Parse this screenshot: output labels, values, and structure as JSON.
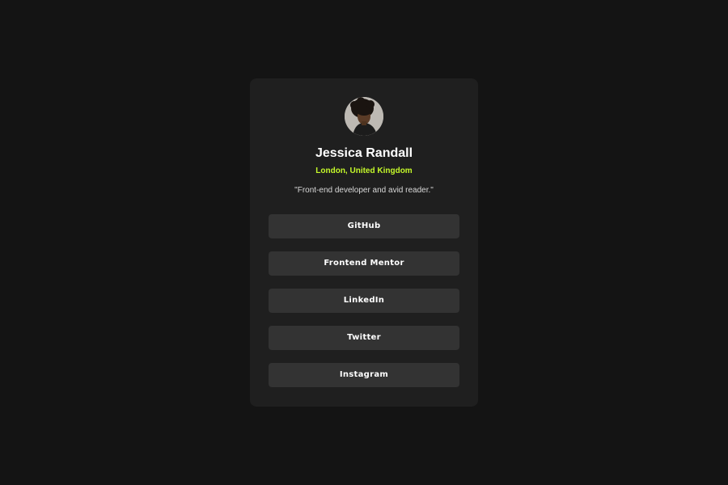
{
  "profile": {
    "name": "Jessica Randall",
    "location": "London, United Kingdom",
    "bio": "\"Front-end developer and avid reader.\""
  },
  "links": [
    {
      "label": "GitHub"
    },
    {
      "label": "Frontend Mentor"
    },
    {
      "label": "LinkedIn"
    },
    {
      "label": "Twitter"
    },
    {
      "label": "Instagram"
    }
  ],
  "colors": {
    "page_background": "#141414",
    "card_background": "#1f1f1f",
    "button_background": "#333333",
    "accent": "#c4f82a",
    "text": "#ffffff"
  }
}
